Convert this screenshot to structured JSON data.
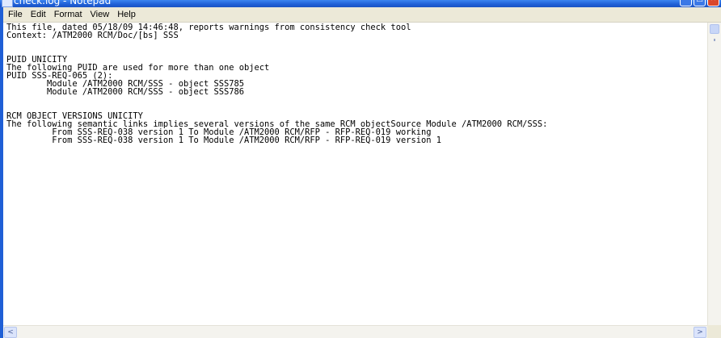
{
  "window": {
    "title": "check.log - Notepad",
    "buttons": {
      "minimize": "–",
      "maximize": "□",
      "close": "✕"
    }
  },
  "menu": {
    "items": [
      "File",
      "Edit",
      "Format",
      "View",
      "Help"
    ]
  },
  "editor": {
    "content": "This file, dated 05/18/09 14:46:48, reports warnings from consistency check tool\nContext: /ATM2000 RCM/Doc/[bs] SSS\n\n\nPUID UNICITY\nThe following PUID are used for more than one object\nPUID SSS-REQ-065 (2):\n        Module /ATM2000 RCM/SSS - object SSS785\n        Module /ATM2000 RCM/SSS - object SSS786\n\n\nRCM OBJECT VERSIONS UNICITY\nThe following semantic links implies several versions of the same RCM objectSource Module /ATM2000 RCM/SSS:\n         From SSS-REQ-038 version 1 To Module /ATM2000 RCM/RFP - RFP-REQ-019 working\n         From SSS-REQ-038 version 1 To Module /ATM2000 RCM/RFP - RFP-REQ-019 version 1"
  },
  "scrollbar": {
    "left_arrow": "<",
    "right_arrow": ">"
  }
}
